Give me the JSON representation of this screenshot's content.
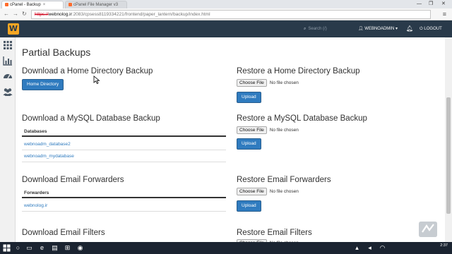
{
  "browser": {
    "tabs": [
      {
        "label": "cPanel - Backup",
        "active": true
      },
      {
        "label": "cPanel File Manager v3",
        "active": false
      }
    ],
    "window_controls": {
      "minimize": "—",
      "maximize": "❐",
      "close": "✕"
    },
    "url": {
      "scheme": "https://",
      "host": "webnolog.ir",
      "path": ":2083/cpsess8119334221/frontend/paper_lantern/backup/index.html"
    }
  },
  "topnav": {
    "logo": "W",
    "search_placeholder": "Search (/)",
    "user": "WEBNOADMIN",
    "logout": "LOGOUT"
  },
  "rail": {
    "icons": [
      "apps-grid-icon",
      "stats-chart-icon",
      "dashboard-gauge-icon",
      "users-icon"
    ]
  },
  "page": {
    "title": "Partial Backups",
    "left": {
      "home": {
        "title": "Download a Home Directory Backup",
        "button": "Home Directory"
      },
      "mysql": {
        "title": "Download a MySQL Database Backup",
        "column": "Databases",
        "rows": [
          "webnoadm_database2",
          "webnoadm_mydatabase"
        ]
      },
      "forwarders": {
        "title": "Download Email Forwarders",
        "column": "Forwarders",
        "rows": [
          "webnolog.ir"
        ]
      },
      "filters": {
        "title": "Download Email Filters"
      }
    },
    "right": {
      "home": {
        "title": "Restore a Home Directory Backup"
      },
      "mysql": {
        "title": "Restore a MySQL Database Backup"
      },
      "forwarders": {
        "title": "Restore Email Forwarders"
      },
      "filters": {
        "title": "Restore Email Filters"
      },
      "choose_label": "Choose File",
      "no_file": "No file chosen",
      "upload": "Upload"
    }
  },
  "taskbar": {
    "time": "2:37"
  },
  "colors": {
    "nav_bg": "#293a4a",
    "accent": "#2f7bbf",
    "logo": "#f6a623"
  }
}
